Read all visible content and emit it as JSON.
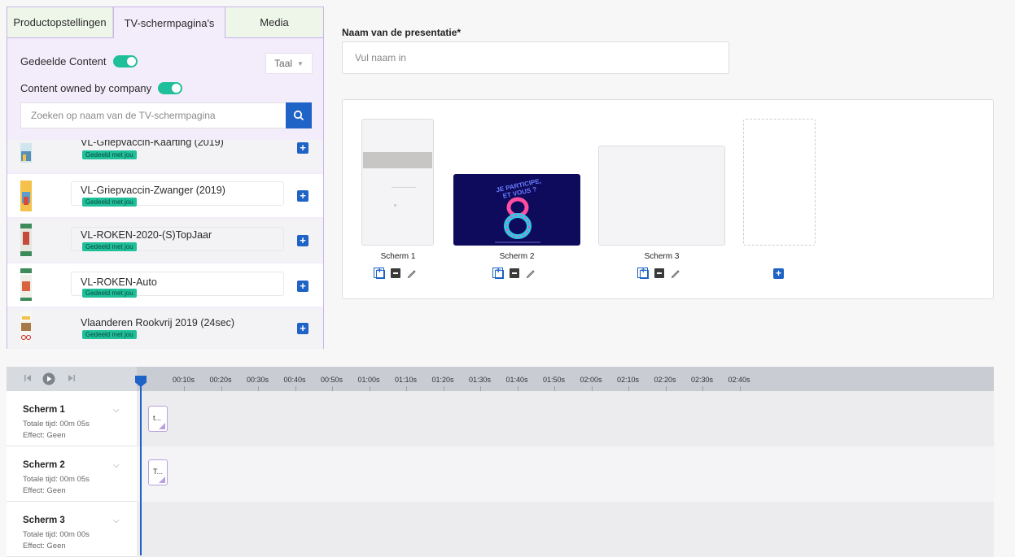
{
  "tabs": [
    {
      "label": "Productopstellingen"
    },
    {
      "label": "TV-schermpagina's"
    },
    {
      "label": "Media"
    }
  ],
  "filters": {
    "shared_content_label": "Gedeelde Content",
    "owned_label": "Content owned by company",
    "language_label": "Taal"
  },
  "search": {
    "placeholder": "Zoeken op naam van de TV-schermpagina"
  },
  "pages": [
    {
      "title": "VL-Griepvaccin-Kaarting (2019)",
      "badge": "Gedeeld met jou"
    },
    {
      "title": "VL-Griepvaccin-Zwanger (2019)",
      "badge": "Gedeeld met jou"
    },
    {
      "title": "VL-ROKEN-2020-(S)TopJaar",
      "badge": "Gedeeld met jou"
    },
    {
      "title": "VL-ROKEN-Auto",
      "badge": "Gedeeld met jou"
    },
    {
      "title": "Vlaanderen Rookvrij 2019 (24sec)",
      "badge": "Gedeeld met jou"
    }
  ],
  "presentation": {
    "name_label": "Naam van de presentatie*",
    "name_placeholder": "Vul naam in"
  },
  "screens": [
    {
      "label": "Scherm 1"
    },
    {
      "label": "Scherm 2"
    },
    {
      "label": "Scherm 3"
    }
  ],
  "screen2_art": {
    "line1": "JE PARTICIPE,",
    "line2": "ET VOUS ?"
  },
  "timeline": {
    "ticks": [
      "00:10s",
      "00:20s",
      "00:30s",
      "00:40s",
      "00:50s",
      "01:00s",
      "01:10s",
      "01:20s",
      "01:30s",
      "01:40s",
      "01:50s",
      "02:00s",
      "02:10s",
      "02:20s",
      "02:30s",
      "02:40s"
    ],
    "rows": [
      {
        "title": "Scherm 1",
        "total": "Totale tijd: 00m 05s",
        "effect": "Effect: Geen",
        "clip": "t..."
      },
      {
        "title": "Scherm 2",
        "total": "Totale tijd: 00m 05s",
        "effect": "Effect: Geen",
        "clip": "T..."
      },
      {
        "title": "Scherm 3",
        "total": "Totale tijd: 00m 00s",
        "effect": "Effect: Geen",
        "clip": ""
      }
    ]
  },
  "colors": {
    "accent": "#1f63c6",
    "toggle": "#1fbf9a",
    "panel_border": "#c9b4e8"
  }
}
